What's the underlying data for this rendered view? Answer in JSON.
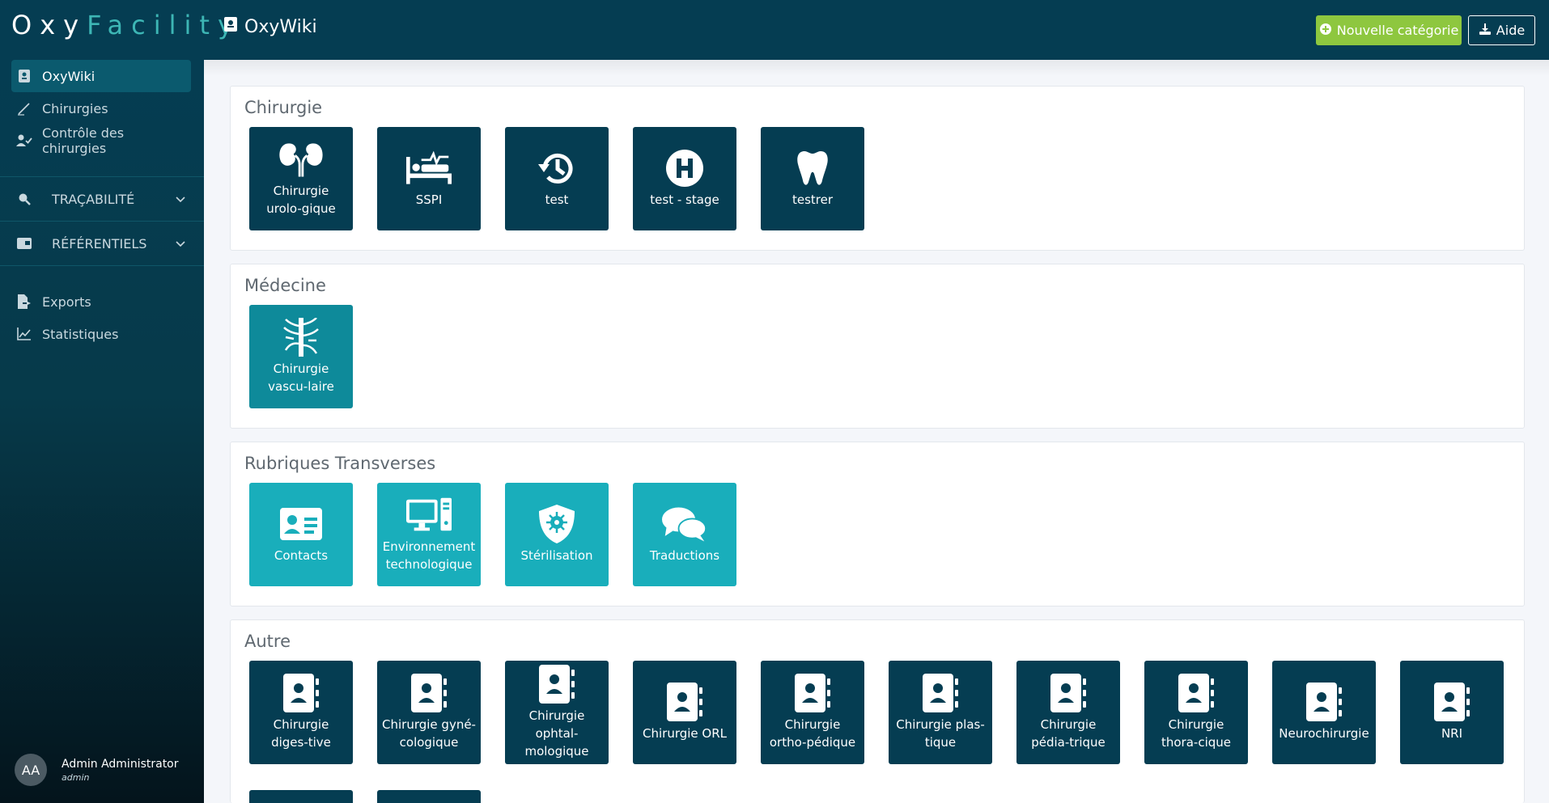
{
  "header": {
    "logo_part1": "Oxy",
    "logo_part2": "Facility",
    "app_title": "OxyWiki",
    "new_category_label": "Nouvelle catégorie",
    "help_label": "Aide"
  },
  "sidebar": {
    "items": [
      {
        "label": "OxyWiki",
        "icon": "wiki-book-icon"
      },
      {
        "label": "Chirurgies",
        "icon": "scalpel-icon"
      },
      {
        "label": "Contrôle des chirurgies",
        "icon": "user-check-icon"
      }
    ],
    "groups": [
      {
        "label": "TRAÇABILITÉ",
        "icon": "search-icon"
      },
      {
        "label": "RÉFÉRENTIELS",
        "icon": "id-card-icon"
      }
    ],
    "bottom_items": [
      {
        "label": "Exports",
        "icon": "file-export-icon"
      },
      {
        "label": "Statistiques",
        "icon": "line-chart-icon"
      }
    ]
  },
  "user": {
    "initials": "AA",
    "name": "Admin Administrator",
    "role": "admin"
  },
  "sections": [
    {
      "title": "Chirurgie",
      "color": "#053d52",
      "tiles": [
        {
          "label": "Chirurgie urolo-gique",
          "icon": "kidneys-icon"
        },
        {
          "label": "SSPI",
          "icon": "hospital-bed-pulse-icon"
        },
        {
          "label": "test",
          "icon": "history-icon"
        },
        {
          "label": "test - stage",
          "icon": "hospital-h-icon"
        },
        {
          "label": "testrer",
          "icon": "tooth-icon"
        }
      ]
    },
    {
      "title": "Médecine",
      "color": "#0e8a9a",
      "tiles": [
        {
          "label": "Chirurgie vascu-laire",
          "icon": "vascular-tree-icon"
        }
      ]
    },
    {
      "title": "Rubriques Transverses",
      "color": "#19aebb",
      "tiles": [
        {
          "label": "Contacts",
          "icon": "contact-card-icon"
        },
        {
          "label": "Environnement technologique",
          "icon": "computer-icon"
        },
        {
          "label": "Stérilisation",
          "icon": "shield-virus-icon"
        },
        {
          "label": "Traductions",
          "icon": "speech-bubbles-icon"
        }
      ]
    },
    {
      "title": "Autre",
      "color": "#053d52",
      "tiles": [
        {
          "label": "Chirurgie diges-tive",
          "icon": "address-book-icon"
        },
        {
          "label": "Chirurgie gyné-cologique",
          "icon": "address-book-icon"
        },
        {
          "label": "Chirurgie ophtal-mologique",
          "icon": "address-book-icon"
        },
        {
          "label": "Chirurgie ORL",
          "icon": "address-book-icon"
        },
        {
          "label": "Chirurgie ortho-pédique",
          "icon": "address-book-icon"
        },
        {
          "label": "Chirurgie plas-tique",
          "icon": "address-book-icon"
        },
        {
          "label": "Chirurgie pédia-trique",
          "icon": "address-book-icon"
        },
        {
          "label": "Chirurgie thora-cique",
          "icon": "address-book-icon"
        },
        {
          "label": "Neurochirurgie",
          "icon": "address-book-icon"
        },
        {
          "label": "NRI",
          "icon": "address-book-icon"
        }
      ]
    }
  ],
  "colors": {
    "header_bg": "#053d52",
    "accent_green": "#8ec73f",
    "logo_teal": "#3db6b5"
  }
}
